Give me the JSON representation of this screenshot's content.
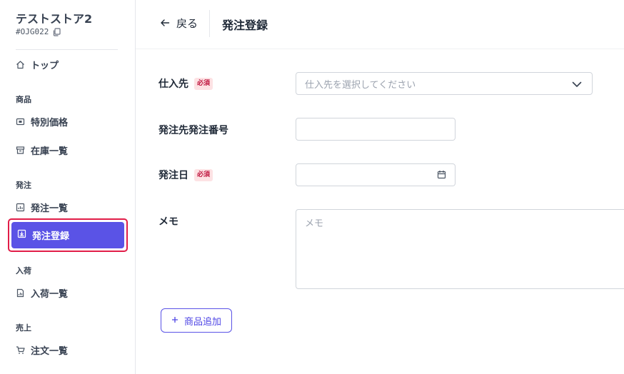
{
  "sidebar": {
    "store_name": "テストストア2",
    "store_code": "#OJG022",
    "top_label": "トップ",
    "sections": {
      "products": "商品",
      "orders": "発注",
      "receiving": "入荷",
      "sales": "売上"
    },
    "items": {
      "special_price": "特別価格",
      "stock_list": "在庫一覧",
      "order_list": "発注一覧",
      "order_register": "発注登録",
      "receiving_list": "入荷一覧",
      "sales_order_list": "注文一覧"
    },
    "active_item": "order_register",
    "accent_color": "#5a53e6",
    "highlight_color": "#e11d48"
  },
  "header": {
    "back_label": "戻る",
    "title": "発注登録"
  },
  "form": {
    "supplier": {
      "label": "仕入先",
      "required_badge": "必須",
      "placeholder": "仕入先を選択してください"
    },
    "supplier_order_number": {
      "label": "発注先発注番号",
      "value": ""
    },
    "order_date": {
      "label": "発注日",
      "required_badge": "必須",
      "value": ""
    },
    "memo": {
      "label": "メモ",
      "placeholder": "メモ",
      "value": ""
    },
    "add_product_label": "商品追加"
  },
  "icons": {
    "store_code": "copy-icon",
    "top": "home-icon",
    "special_price": "price-tag-icon",
    "stock_list": "archive-box-icon",
    "order_list": "chart-icon",
    "order_register": "inbox-download-icon",
    "receiving_list": "document-chart-icon",
    "sales_order_list": "cart-icon",
    "back": "arrow-left-icon",
    "supplier_select": "chevron-down-icon",
    "order_date": "calendar-icon",
    "add_product": "plus-icon"
  }
}
